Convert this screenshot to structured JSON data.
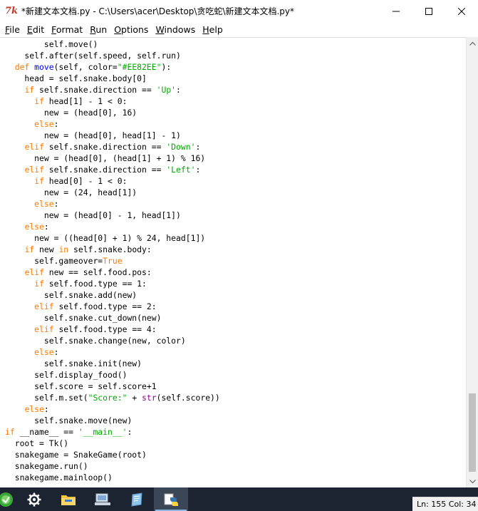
{
  "window": {
    "title": "*新建文本文档.py - C:\\Users\\acer\\Desktop\\贪吃蛇\\新建文本文档.py*",
    "app_icon_glyph": "7k",
    "controls": {
      "minimize": "minimize-icon",
      "maximize": "maximize-icon",
      "close": "close-icon"
    }
  },
  "menu": {
    "items": [
      {
        "label": "File",
        "accel": "F",
        "rest": "ile"
      },
      {
        "label": "Edit",
        "accel": "E",
        "rest": "dit"
      },
      {
        "label": "Format",
        "accel": "F",
        "rest": "ormat"
      },
      {
        "label": "Run",
        "accel": "R",
        "rest": "un"
      },
      {
        "label": "Options",
        "accel": "O",
        "rest": "ptions"
      },
      {
        "label": "Windows",
        "accel": "W",
        "rest": "indows"
      },
      {
        "label": "Help",
        "accel": "H",
        "rest": "elp"
      }
    ]
  },
  "editor": {
    "lines": [
      [
        [
          "        self.move()",
          "n"
        ]
      ],
      [
        [
          "    self.after(self.speed, self.run)",
          "n"
        ]
      ],
      [
        [
          "  ",
          "n"
        ],
        [
          "def",
          "kw"
        ],
        [
          " ",
          "n"
        ],
        [
          "move",
          "def"
        ],
        [
          "(self, color=",
          "n"
        ],
        [
          "\"#EE82EE\"",
          "str"
        ],
        [
          "):",
          "n"
        ]
      ],
      [
        [
          "    head = self.snake.body[0]",
          "n"
        ]
      ],
      [
        [
          "    ",
          "n"
        ],
        [
          "if",
          "kw"
        ],
        [
          " self.snake.direction == ",
          "n"
        ],
        [
          "'Up'",
          "str"
        ],
        [
          ":",
          "n"
        ]
      ],
      [
        [
          "      ",
          "n"
        ],
        [
          "if",
          "kw"
        ],
        [
          " head[1] - 1 < 0:",
          "n"
        ]
      ],
      [
        [
          "        new = (head[0], 16)",
          "n"
        ]
      ],
      [
        [
          "      ",
          "n"
        ],
        [
          "else",
          "kw"
        ],
        [
          ":",
          "n"
        ]
      ],
      [
        [
          "        new = (head[0], head[1] - 1)",
          "n"
        ]
      ],
      [
        [
          "    ",
          "n"
        ],
        [
          "elif",
          "kw"
        ],
        [
          " self.snake.direction == ",
          "n"
        ],
        [
          "'Down'",
          "str"
        ],
        [
          ":",
          "n"
        ]
      ],
      [
        [
          "      new = (head[0], (head[1] + 1) % 16)",
          "n"
        ]
      ],
      [
        [
          "    ",
          "n"
        ],
        [
          "elif",
          "kw"
        ],
        [
          " self.snake.direction == ",
          "n"
        ],
        [
          "'Left'",
          "str"
        ],
        [
          ":",
          "n"
        ]
      ],
      [
        [
          "      ",
          "n"
        ],
        [
          "if",
          "kw"
        ],
        [
          " head[0] - 1 < 0:",
          "n"
        ]
      ],
      [
        [
          "        new = (24, head[1])",
          "n"
        ]
      ],
      [
        [
          "      ",
          "n"
        ],
        [
          "else",
          "kw"
        ],
        [
          ":",
          "n"
        ]
      ],
      [
        [
          "        new = (head[0] - 1, head[1])",
          "n"
        ]
      ],
      [
        [
          "    ",
          "n"
        ],
        [
          "else",
          "kw"
        ],
        [
          ":",
          "n"
        ]
      ],
      [
        [
          "      new = ((head[0] + 1) % 24, head[1])",
          "n"
        ]
      ],
      [
        [
          "    ",
          "n"
        ],
        [
          "if",
          "kw"
        ],
        [
          " new ",
          "n"
        ],
        [
          "in",
          "kw"
        ],
        [
          " self.snake.body:",
          "n"
        ]
      ],
      [
        [
          "      self.gameover=",
          "n"
        ],
        [
          "True",
          "kw"
        ]
      ],
      [
        [
          "    ",
          "n"
        ],
        [
          "elif",
          "kw"
        ],
        [
          " new == self.food.pos:",
          "n"
        ]
      ],
      [
        [
          "      ",
          "n"
        ],
        [
          "if",
          "kw"
        ],
        [
          " self.food.type == 1:",
          "n"
        ]
      ],
      [
        [
          "        self.snake.add(new)",
          "n"
        ]
      ],
      [
        [
          "      ",
          "n"
        ],
        [
          "elif",
          "kw"
        ],
        [
          " self.food.type == 2:",
          "n"
        ]
      ],
      [
        [
          "        self.snake.cut_down(new)",
          "n"
        ]
      ],
      [
        [
          "      ",
          "n"
        ],
        [
          "elif",
          "kw"
        ],
        [
          " self.food.type == 4:",
          "n"
        ]
      ],
      [
        [
          "        self.snake.change(new, color)",
          "n"
        ]
      ],
      [
        [
          "      ",
          "n"
        ],
        [
          "else",
          "kw"
        ],
        [
          ":",
          "n"
        ]
      ],
      [
        [
          "        self.snake.init(new)",
          "n"
        ]
      ],
      [
        [
          "      self.display_food()",
          "n"
        ]
      ],
      [
        [
          "      self.score = self.score+1",
          "n"
        ]
      ],
      [
        [
          "      self.m.set(",
          "n"
        ],
        [
          "\"Score:\"",
          "str"
        ],
        [
          " + ",
          "n"
        ],
        [
          "str",
          "bi"
        ],
        [
          "(self.score))",
          "n"
        ]
      ],
      [
        [
          "    ",
          "n"
        ],
        [
          "else",
          "kw"
        ],
        [
          ":",
          "n"
        ]
      ],
      [
        [
          "      self.snake.move(new)",
          "n"
        ]
      ],
      [
        [
          "if",
          "kw"
        ],
        [
          " __name__ == ",
          "n"
        ],
        [
          "'__main__'",
          "str"
        ],
        [
          ":",
          "n"
        ]
      ],
      [
        [
          "  root = Tk()",
          "n"
        ]
      ],
      [
        [
          "  snakegame = SnakeGame(root)",
          "n"
        ]
      ],
      [
        [
          "  snakegame.run()",
          "n"
        ]
      ],
      [
        [
          "  snakegame.mainloop()",
          "n"
        ]
      ]
    ]
  },
  "statusbar": {
    "text": "Ln: 155 Col: 34"
  },
  "taskbar": {
    "items": [
      {
        "name": "start-partial-icon",
        "active": false
      },
      {
        "name": "settings-gear-icon",
        "active": false
      },
      {
        "name": "file-explorer-folder-icon",
        "active": false
      },
      {
        "name": "remote-desktop-icon",
        "active": false
      },
      {
        "name": "notepad-icon",
        "active": false
      },
      {
        "name": "python-idle-icon",
        "active": true
      }
    ]
  },
  "colors": {
    "keyword": "#ff7700",
    "string": "#00aa00",
    "definition": "#0000ff",
    "builtin": "#900090",
    "taskbar": "#1b2430"
  }
}
